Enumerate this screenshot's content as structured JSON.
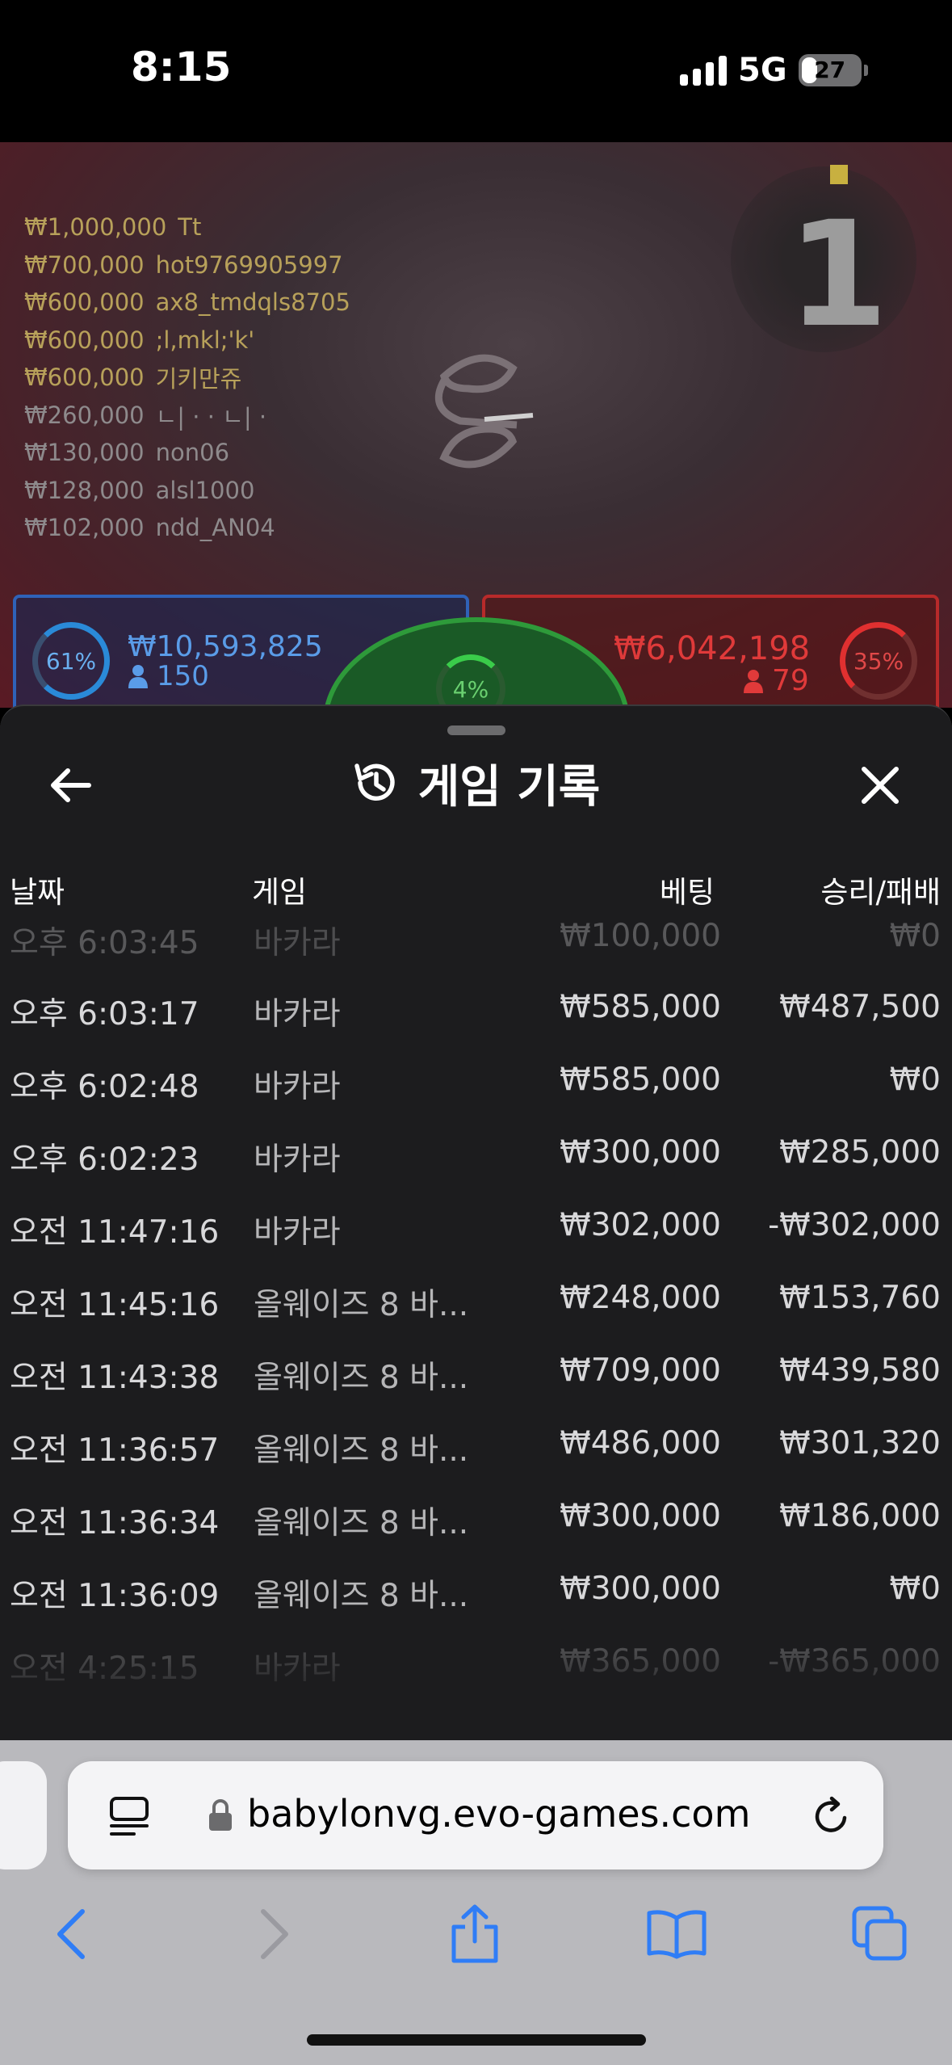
{
  "status_bar": {
    "time": "8:15",
    "network": "5G",
    "battery": "27"
  },
  "game": {
    "round_number": "1",
    "bettors": [
      {
        "amount": "₩1,000,000",
        "name": "Tt",
        "dim": false
      },
      {
        "amount": "₩700,000",
        "name": "hot9769905997",
        "dim": false
      },
      {
        "amount": "₩600,000",
        "name": "ax8_tmdqls8705",
        "dim": false
      },
      {
        "amount": "₩600,000",
        "name": ";l,mkl;'k'",
        "dim": false
      },
      {
        "amount": "₩600,000",
        "name": "기키만쥬",
        "dim": false
      },
      {
        "amount": "₩260,000",
        "name": "ㄴ| · · ㄴ| ·",
        "dim": true
      },
      {
        "amount": "₩130,000",
        "name": "non06",
        "dim": true
      },
      {
        "amount": "₩128,000",
        "name": "alsl1000",
        "dim": true
      },
      {
        "amount": "₩102,000",
        "name": "ndd_AN04",
        "dim": true
      }
    ],
    "player": {
      "percent": "61%",
      "amount": "₩10,593,825",
      "count": "150"
    },
    "tie": {
      "percent": "4%"
    },
    "banker": {
      "percent": "35%",
      "amount": "₩6,042,198",
      "count": "79"
    }
  },
  "sheet": {
    "title": "게임 기록",
    "columns": {
      "date": "날짜",
      "game": "게임",
      "bet": "베팅",
      "result": "승리/패배"
    },
    "rows": [
      {
        "date": "오후 6:03:45",
        "game": "바카라",
        "bet": "₩100,000",
        "result": "₩0"
      },
      {
        "date": "오후 6:03:17",
        "game": "바카라",
        "bet": "₩585,000",
        "result": "₩487,500"
      },
      {
        "date": "오후 6:02:48",
        "game": "바카라",
        "bet": "₩585,000",
        "result": "₩0"
      },
      {
        "date": "오후 6:02:23",
        "game": "바카라",
        "bet": "₩300,000",
        "result": "₩285,000"
      },
      {
        "date": "오전 11:47:16",
        "game": "바카라",
        "bet": "₩302,000",
        "result": "-₩302,000"
      },
      {
        "date": "오전 11:45:16",
        "game": "올웨이즈 8 바...",
        "bet": "₩248,000",
        "result": "₩153,760"
      },
      {
        "date": "오전 11:43:38",
        "game": "올웨이즈 8 바...",
        "bet": "₩709,000",
        "result": "₩439,580"
      },
      {
        "date": "오전 11:36:57",
        "game": "올웨이즈 8 바...",
        "bet": "₩486,000",
        "result": "₩301,320"
      },
      {
        "date": "오전 11:36:34",
        "game": "올웨이즈 8 바...",
        "bet": "₩300,000",
        "result": "₩186,000"
      },
      {
        "date": "오전 11:36:09",
        "game": "올웨이즈 8 바...",
        "bet": "₩300,000",
        "result": "₩0"
      },
      {
        "date": "오전 4:25:15",
        "game": "바카라",
        "bet": "₩365,000",
        "result": "-₩365,000"
      }
    ]
  },
  "browser": {
    "url": "babylonvg.evo-games.com"
  },
  "colors": {
    "sheet_bg": "#1c1c1e",
    "player_blue": "#2f62b8",
    "banker_red": "#b82a2a",
    "tie_green": "#2e9a3a",
    "ios_blue": "#2f7df6"
  }
}
